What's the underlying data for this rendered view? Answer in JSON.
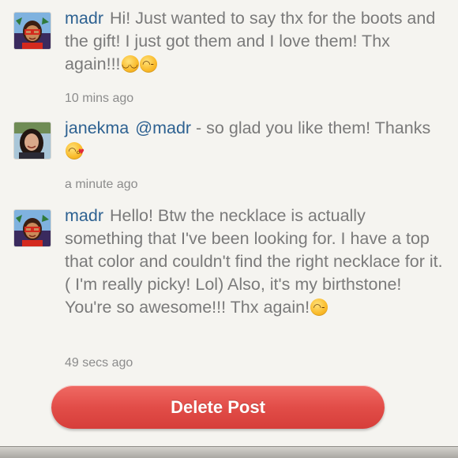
{
  "comments": [
    {
      "username": "madr",
      "text": "Hi! Just wanted to say thx for the boots and the gift! I just got them and I love them! Thx again!!!",
      "emojis": [
        "smiling-blush-emoji",
        "wink-emoji"
      ],
      "time": "10 mins ago"
    },
    {
      "username": "janekma",
      "mention": "@madr",
      "text": " - so glad you like them! Thanks",
      "emojis": [
        "kiss-emoji"
      ],
      "time": "a minute ago"
    },
    {
      "username": "madr",
      "text": "Hello! Btw the necklace is actually something that I've been looking for. I have a top that color and couldn't find the right necklace for it.( I'm really picky! Lol) Also, it's my birthstone! You're so awesome!!! Thx again!",
      "emojis": [
        "wink-emoji"
      ],
      "time": "49 secs ago"
    }
  ],
  "delete_button": {
    "label": "Delete Post",
    "color": "#e24d48"
  },
  "colors": {
    "username": "#2d6191",
    "text": "#7a7a7a",
    "background": "#f5f4f0"
  }
}
